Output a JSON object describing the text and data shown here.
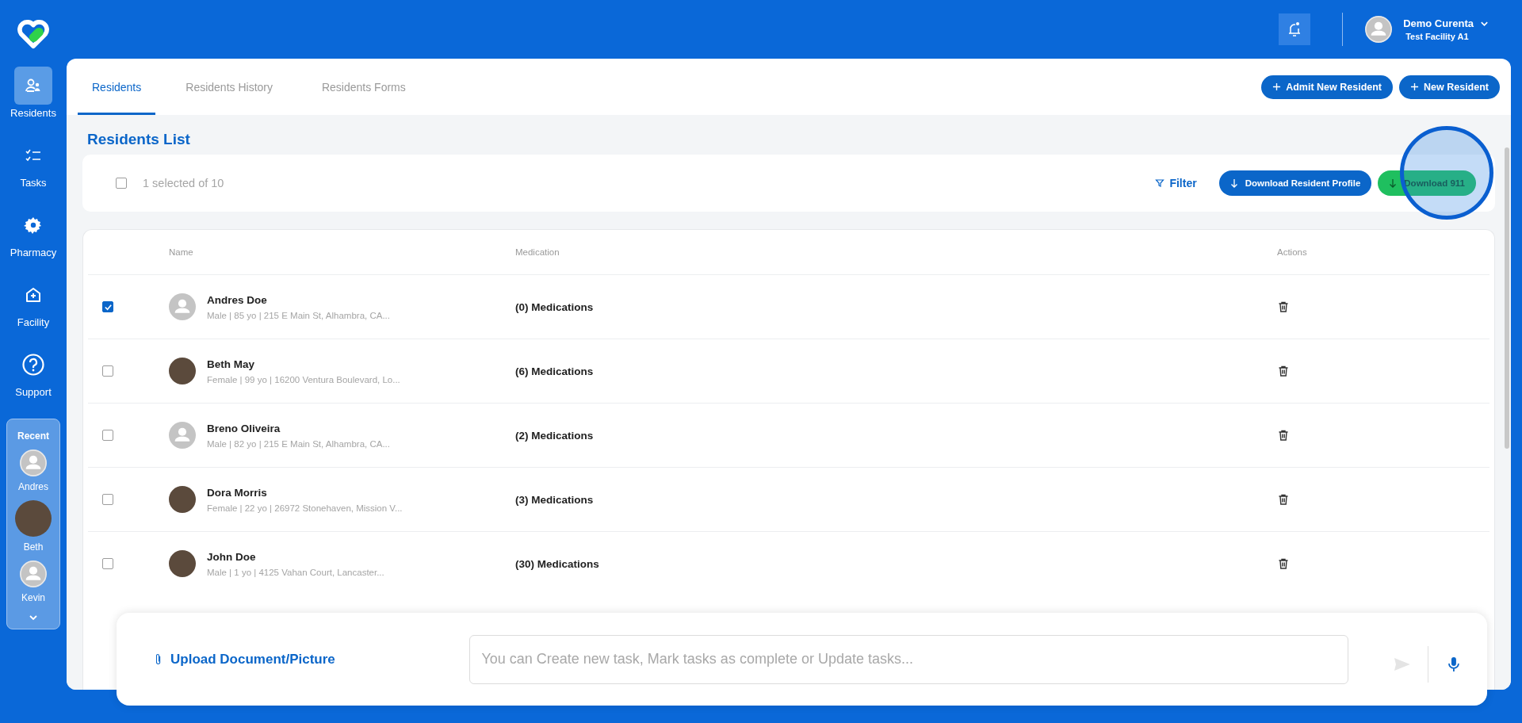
{
  "sidebar": {
    "items": [
      {
        "label": "Residents",
        "kind": "residents",
        "selected": true
      },
      {
        "label": "Tasks",
        "kind": "tasks",
        "selected": false
      },
      {
        "label": "Pharmacy",
        "kind": "pharmacy",
        "selected": false
      },
      {
        "label": "Facility",
        "kind": "facility",
        "selected": false
      },
      {
        "label": "Support",
        "kind": "support",
        "selected": false
      }
    ]
  },
  "recent": {
    "title": "Recent",
    "people": [
      {
        "name": "Andres",
        "photo": false
      },
      {
        "name": "Beth",
        "photo": true
      },
      {
        "name": "Kevin",
        "photo": false
      }
    ]
  },
  "header": {
    "user_name": "Demo Curenta",
    "facility": "Test Facility A1"
  },
  "tabs": [
    {
      "label": "Residents",
      "selected": true
    },
    {
      "label": "Residents History",
      "selected": false
    },
    {
      "label": "Residents Forms",
      "selected": false
    }
  ],
  "actions": [
    "Admit New Resident",
    "New Resident"
  ],
  "list": {
    "title": "Residents List",
    "select_all_checked": false,
    "selection_text": "1 selected of 10",
    "filter": "Filter",
    "download_profile": "Download Resident Profile",
    "download_911": "Download 911"
  },
  "table": {
    "columns": [
      "Name",
      "Medication",
      "Actions"
    ],
    "rows": [
      {
        "checked": true,
        "photo": false,
        "name": "Andres Doe",
        "details": "Male | 85 yo | 215 E Main St, Alhambra, CA...",
        "medications": "(0) Medications"
      },
      {
        "checked": false,
        "photo": true,
        "name": "Beth May",
        "details": "Female | 99 yo | 16200 Ventura Boulevard, Lo...",
        "medications": "(6) Medications"
      },
      {
        "checked": false,
        "photo": false,
        "name": "Breno Oliveira",
        "details": "Male | 82 yo | 215 E Main St, Alhambra, CA...",
        "medications": "(2) Medications"
      },
      {
        "checked": false,
        "photo": true,
        "name": "Dora Morris",
        "details": "Female | 22 yo | 26972 Stonehaven, Mission V...",
        "medications": "(3) Medications"
      },
      {
        "checked": false,
        "photo": true,
        "name": "John Doe",
        "details": "Male | 1 yo | 4125 Vahan Court, Lancaster...",
        "medications": "(30) Medications"
      }
    ]
  },
  "composer": {
    "upload": "Upload Document/Picture",
    "placeholder": "You can Create new task, Mark tasks as complete or Update tasks..."
  }
}
